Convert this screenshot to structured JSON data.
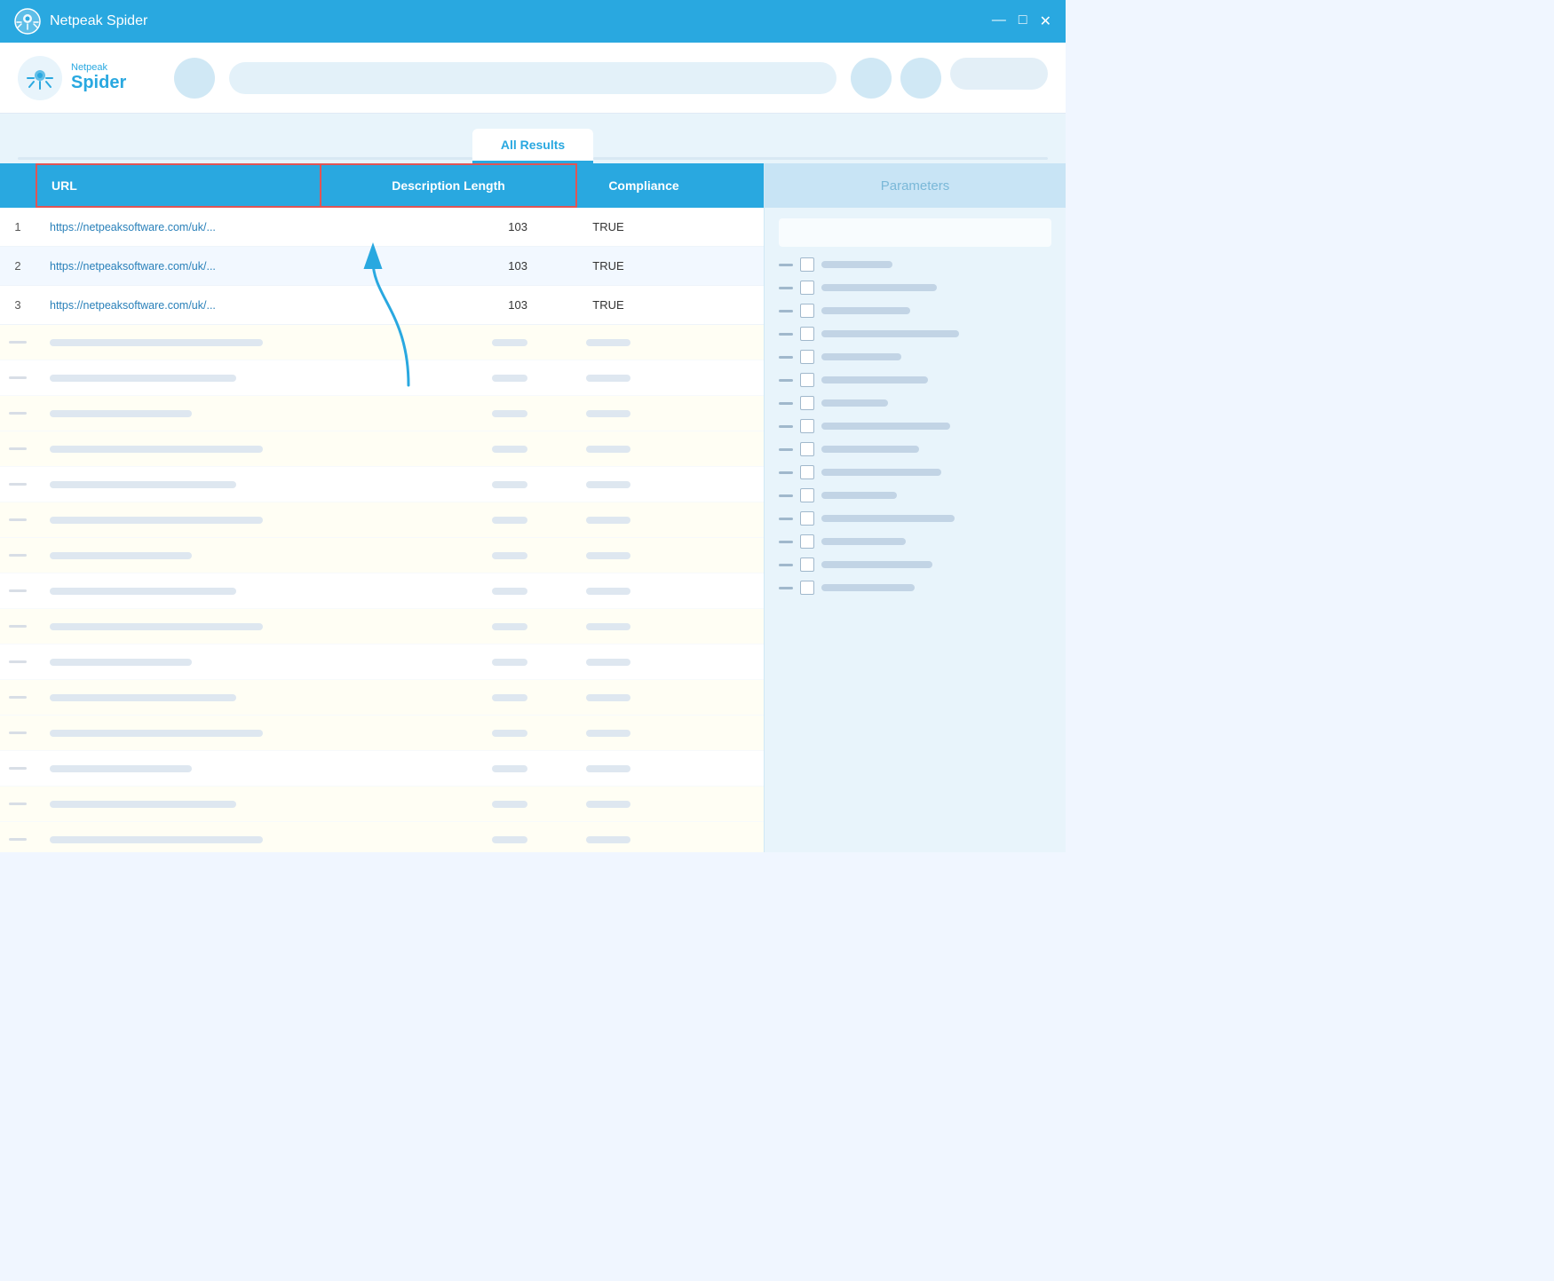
{
  "titleBar": {
    "title": "Netpeak Spider",
    "controls": [
      "—",
      "□",
      "✕"
    ]
  },
  "appHeader": {
    "logoText1": "Netpeak",
    "logoText2": "Spider"
  },
  "tabs": {
    "active": "All Results",
    "panelTitle": "Parameters"
  },
  "tableHeaders": {
    "url": "URL",
    "descLength": "Description Length",
    "compliance": "Compliance"
  },
  "rows": [
    {
      "num": "1",
      "url": "https://netpeaksoftware.com/uk/...",
      "desc": "103",
      "compliance": "TRUE"
    },
    {
      "num": "2",
      "url": "https://netpeaksoftware.com/uk/...",
      "desc": "103",
      "compliance": "TRUE"
    },
    {
      "num": "3",
      "url": "https://netpeaksoftware.com/uk/...",
      "desc": "103",
      "compliance": "TRUE"
    }
  ],
  "blurredRows": [
    {
      "bg": "yellow"
    },
    {
      "bg": "white"
    },
    {
      "bg": "yellow"
    },
    {
      "bg": "yellow"
    },
    {
      "bg": "white"
    },
    {
      "bg": "yellow"
    },
    {
      "bg": "yellow"
    },
    {
      "bg": "white"
    },
    {
      "bg": "yellow"
    },
    {
      "bg": "yellow"
    },
    {
      "bg": "white"
    },
    {
      "bg": "yellow"
    },
    {
      "bg": "white"
    },
    {
      "bg": "yellow"
    },
    {
      "bg": "yellow"
    },
    {
      "bg": "white"
    }
  ],
  "paramItems": [
    {
      "labelWidth": 80
    },
    {
      "labelWidth": 130
    },
    {
      "labelWidth": 100
    },
    {
      "labelWidth": 155
    },
    {
      "labelWidth": 90
    },
    {
      "labelWidth": 120
    },
    {
      "labelWidth": 75
    },
    {
      "labelWidth": 145
    },
    {
      "labelWidth": 110
    },
    {
      "labelWidth": 135
    },
    {
      "labelWidth": 85
    },
    {
      "labelWidth": 150
    },
    {
      "labelWidth": 95
    },
    {
      "labelWidth": 125
    },
    {
      "labelWidth": 105
    }
  ]
}
